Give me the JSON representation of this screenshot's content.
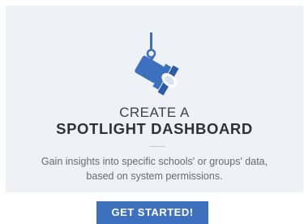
{
  "card": {
    "icon": "spotlight-icon",
    "title_line1": "CREATE A",
    "title_line2": "SPOTLIGHT DASHBOARD",
    "description_line1": "Gain insights into specific schools' or groups' data,",
    "description_line2": "based on system permissions."
  },
  "cta": {
    "label": "GET STARTED!"
  },
  "colors": {
    "card_background": "#eef1f6",
    "accent": "#3e70c0",
    "title": "#2f3338",
    "body_text": "#676b72"
  }
}
